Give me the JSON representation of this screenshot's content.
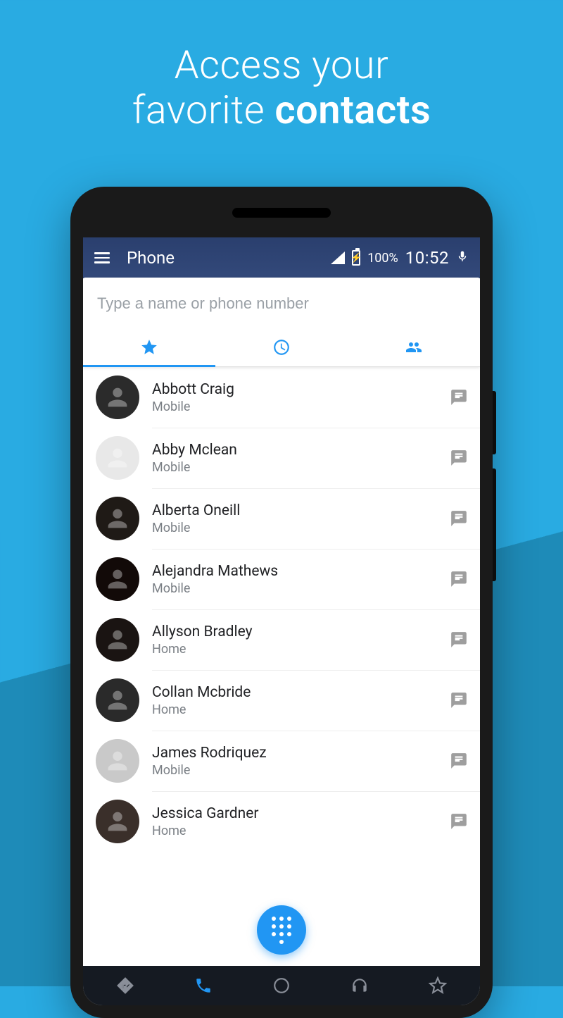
{
  "headline_line1": "Access your",
  "headline_line2_pre": "favorite ",
  "headline_line2_bold": "contacts",
  "statusbar": {
    "title": "Phone",
    "battery_pct": "100%",
    "time": "10:52"
  },
  "search": {
    "placeholder": "Type a name or phone number"
  },
  "contacts": [
    {
      "name": "Abbott Craig",
      "label": "Mobile",
      "avatar_bg": "#2b2b2b"
    },
    {
      "name": "Abby Mclean",
      "label": "Mobile",
      "avatar_bg": "#e8e8e8"
    },
    {
      "name": "Alberta Oneill",
      "label": "Mobile",
      "avatar_bg": "#1f1a16"
    },
    {
      "name": "Alejandra Mathews",
      "label": "Mobile",
      "avatar_bg": "#120a08"
    },
    {
      "name": "Allyson Bradley",
      "label": "Home",
      "avatar_bg": "#1a1412"
    },
    {
      "name": "Collan Mcbride",
      "label": "Home",
      "avatar_bg": "#2a2a2a"
    },
    {
      "name": "James Rodriquez",
      "label": "Mobile",
      "avatar_bg": "#c9c9c9"
    },
    {
      "name": "Jessica Gardner",
      "label": "Home",
      "avatar_bg": "#3a2f2a"
    }
  ],
  "icons": {
    "accent": "#2196f3"
  }
}
